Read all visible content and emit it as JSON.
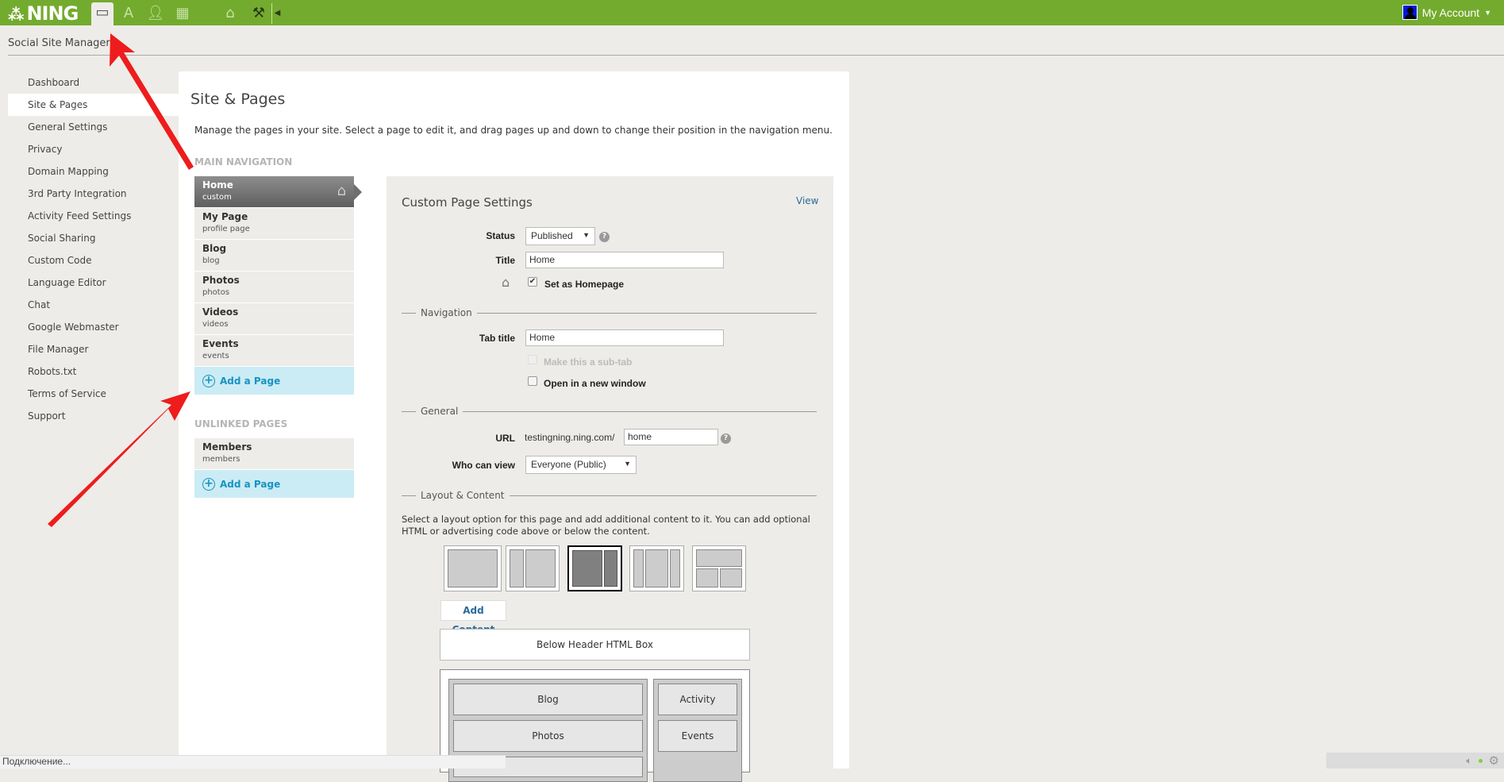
{
  "topbar": {
    "logo": "NING",
    "icons": [
      "browser-window-icon",
      "app-store-icon",
      "user-icon",
      "grid-icon",
      "home-icon",
      "tools-icon",
      "collapse-arrow-icon"
    ],
    "account": "My Account",
    "brand_color": "#73ab2e"
  },
  "header": {
    "title": "Social Site Manager"
  },
  "sidebar": {
    "items": [
      {
        "label": "Dashboard"
      },
      {
        "label": "Site & Pages",
        "active": true
      },
      {
        "label": "General Settings"
      },
      {
        "label": "Privacy"
      },
      {
        "label": "Domain Mapping"
      },
      {
        "label": "3rd Party Integration"
      },
      {
        "label": "Activity Feed Settings"
      },
      {
        "label": "Social Sharing"
      },
      {
        "label": "Custom Code"
      },
      {
        "label": "Language Editor"
      },
      {
        "label": "Chat"
      },
      {
        "label": "Google Webmaster"
      },
      {
        "label": "File Manager"
      },
      {
        "label": "Robots.txt"
      },
      {
        "label": "Terms of Service"
      },
      {
        "label": "Support"
      }
    ]
  },
  "main": {
    "title": "Site & Pages",
    "description": "Manage the pages in your site. Select a page to edit it, and drag pages up and down to change their position in the navigation menu.",
    "main_nav_label": "MAIN NAVIGATION",
    "main_nav": [
      {
        "name": "Home",
        "type": "custom"
      },
      {
        "name": "My Page",
        "type": "profile page"
      },
      {
        "name": "Blog",
        "type": "blog"
      },
      {
        "name": "Photos",
        "type": "photos"
      },
      {
        "name": "Videos",
        "type": "videos"
      },
      {
        "name": "Events",
        "type": "events"
      }
    ],
    "add_page": "Add a Page",
    "unlinked_label": "UNLINKED PAGES",
    "unlinked": [
      {
        "name": "Members",
        "type": "members"
      }
    ]
  },
  "settings": {
    "title": "Custom Page Settings",
    "view": "View",
    "status_label": "Status",
    "status_value": "Published",
    "title_label": "Title",
    "title_value": "Home",
    "homepage": "Set as Homepage",
    "homepage_checked": true,
    "nav_section": "Navigation",
    "tab_title_label": "Tab title",
    "tab_title_value": "Home",
    "subtab": "Make this a sub-tab",
    "subtab_disabled": true,
    "new_window": "Open in a new window",
    "new_window_checked": false,
    "general_section": "General",
    "url_label": "URL",
    "url_prefix": "testingning.ning.com/",
    "url_value": "home",
    "who_label": "Who can view",
    "who_value": "Everyone (Public)",
    "layout_section": "Layout & Content",
    "layout_text": "Select a layout option for this page and add additional content to it. You can add optional HTML or advertising code above or below the content.",
    "selected_layout": 3,
    "add_content": "Add Content",
    "below_header": "Below Header HTML Box",
    "left_modules": [
      "Blog",
      "Photos"
    ],
    "right_modules": [
      "Activity",
      "Events"
    ]
  },
  "statusbar": {
    "text": "Подключение..."
  }
}
